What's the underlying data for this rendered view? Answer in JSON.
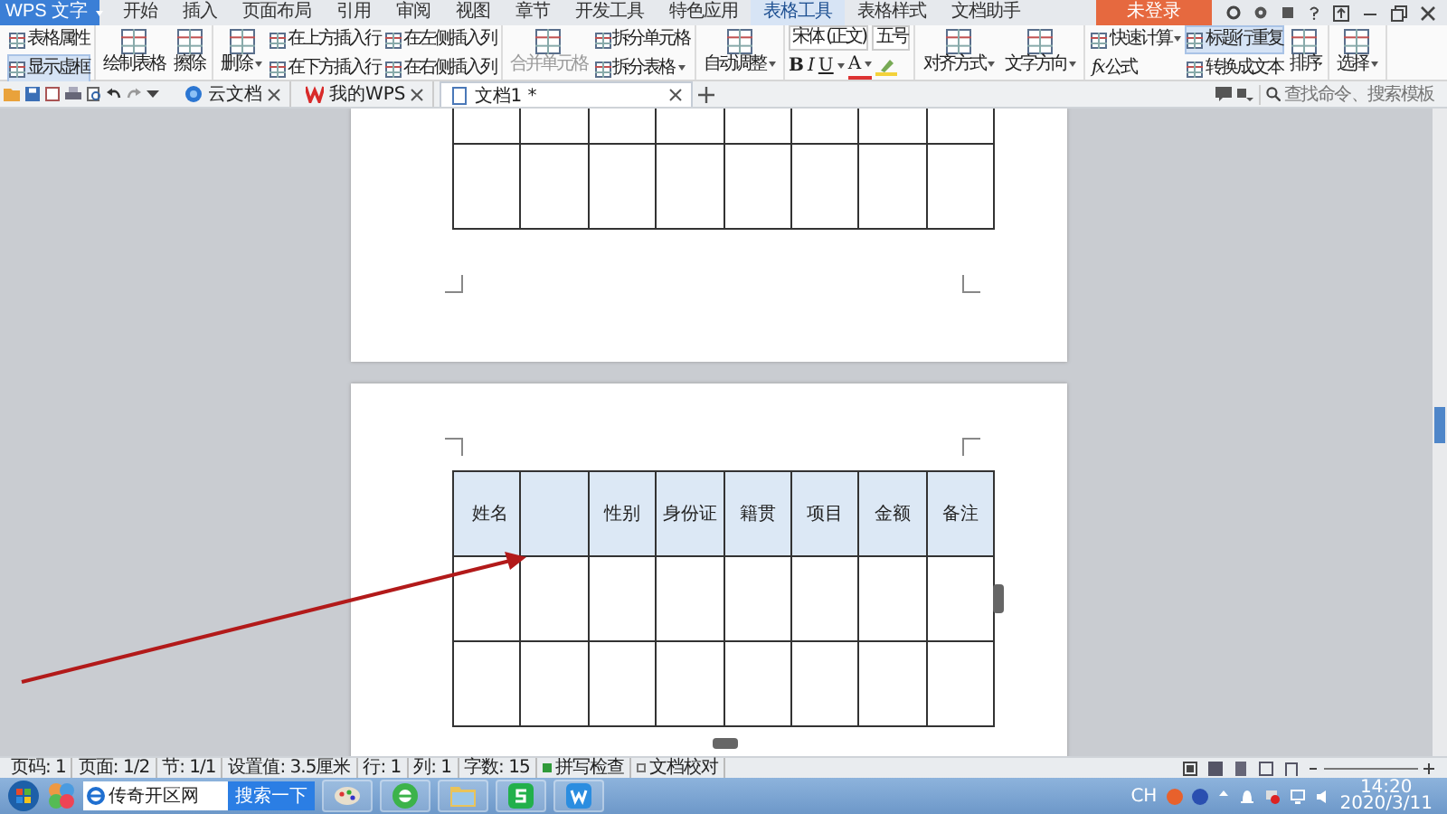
{
  "app_button": {
    "label": "WPS 文字"
  },
  "menu_tabs": [
    {
      "label": "开始",
      "selected": false
    },
    {
      "label": "插入",
      "selected": false
    },
    {
      "label": "页面布局",
      "selected": false
    },
    {
      "label": "引用",
      "selected": false
    },
    {
      "label": "审阅",
      "selected": false
    },
    {
      "label": "视图",
      "selected": false
    },
    {
      "label": "章节",
      "selected": false
    },
    {
      "label": "开发工具",
      "selected": false
    },
    {
      "label": "特色应用",
      "selected": false
    },
    {
      "label": "表格工具",
      "selected": true
    },
    {
      "label": "表格样式",
      "selected": false
    },
    {
      "label": "文档助手",
      "selected": false
    }
  ],
  "login_button": {
    "label": "未登录"
  },
  "ribbon": [
    {
      "columns": [
        {
          "kind": "small",
          "items": [
            {
              "label": "表格属性",
              "selected": false,
              "disabled": false,
              "dropdown": false
            },
            {
              "label": "显示虚框",
              "selected": true,
              "disabled": false,
              "dropdown": false
            }
          ]
        }
      ]
    },
    {
      "columns": [
        {
          "kind": "large",
          "items": [
            {
              "label": "绘制表格",
              "selected": false,
              "disabled": false,
              "dropdown": false
            }
          ]
        },
        {
          "kind": "large",
          "items": [
            {
              "label": "擦除",
              "selected": false,
              "disabled": false,
              "dropdown": false
            }
          ]
        }
      ]
    },
    {
      "columns": [
        {
          "kind": "large",
          "items": [
            {
              "label": "删除",
              "selected": false,
              "disabled": false,
              "dropdown": true
            }
          ]
        },
        {
          "kind": "small",
          "items": [
            {
              "label": "在上方插入行",
              "selected": false,
              "disabled": false,
              "dropdown": false
            },
            {
              "label": "在下方插入行",
              "selected": false,
              "disabled": false,
              "dropdown": false
            }
          ]
        },
        {
          "kind": "small",
          "items": [
            {
              "label": "在左侧插入列",
              "selected": false,
              "disabled": false,
              "dropdown": false
            },
            {
              "label": "在右侧插入列",
              "selected": false,
              "disabled": false,
              "dropdown": false
            }
          ]
        }
      ]
    },
    {
      "columns": [
        {
          "kind": "large",
          "items": [
            {
              "label": "合并单元格",
              "selected": false,
              "disabled": true,
              "dropdown": false
            }
          ]
        },
        {
          "kind": "small",
          "items": [
            {
              "label": "拆分单元格",
              "selected": false,
              "disabled": false,
              "dropdown": false
            },
            {
              "label": "拆分表格",
              "selected": false,
              "disabled": false,
              "dropdown": true
            }
          ]
        }
      ]
    },
    {
      "columns": [
        {
          "kind": "large",
          "items": [
            {
              "label": "自动调整",
              "selected": false,
              "disabled": false,
              "dropdown": true
            }
          ]
        }
      ]
    },
    {
      "columns": [
        {
          "kind": "font",
          "font_name": "宋体 (正文)",
          "font_size": "五号",
          "items": [
            {
              "label": "B",
              "selected": false,
              "disabled": false,
              "dropdown": false
            },
            {
              "label": "I",
              "selected": false,
              "disabled": false,
              "dropdown": false
            },
            {
              "label": "U",
              "selected": false,
              "disabled": false,
              "dropdown": true
            },
            {
              "label": "A",
              "selected": false,
              "disabled": false,
              "dropdown": true
            }
          ]
        }
      ]
    },
    {
      "columns": [
        {
          "kind": "large",
          "items": [
            {
              "label": "对齐方式",
              "selected": false,
              "disabled": false,
              "dropdown": true
            }
          ]
        },
        {
          "kind": "large",
          "items": [
            {
              "label": "文字方向",
              "selected": false,
              "disabled": false,
              "dropdown": true
            }
          ]
        }
      ]
    },
    {
      "columns": [
        {
          "kind": "small",
          "items": [
            {
              "label": "快速计算",
              "selected": false,
              "disabled": false,
              "dropdown": true
            },
            {
              "label": "公式",
              "symbol": "fx",
              "selected": false,
              "disabled": false,
              "dropdown": false
            }
          ]
        },
        {
          "kind": "small",
          "items": [
            {
              "label": "标题行重复",
              "selected": true,
              "disabled": false,
              "dropdown": false
            },
            {
              "label": "转换成文本",
              "selected": false,
              "disabled": false,
              "dropdown": false
            }
          ]
        },
        {
          "kind": "large",
          "items": [
            {
              "label": "排序",
              "selected": false,
              "disabled": false,
              "dropdown": false
            }
          ]
        }
      ]
    },
    {
      "columns": [
        {
          "kind": "large",
          "items": [
            {
              "label": "选择",
              "selected": false,
              "disabled": false,
              "dropdown": true
            }
          ]
        }
      ]
    }
  ],
  "doc_tabs": [
    {
      "label": "云文档",
      "selected": false
    },
    {
      "label": "我的WPS",
      "selected": false
    },
    {
      "label": "文档1 *",
      "selected": true
    }
  ],
  "command_search": {
    "placeholder": "查找命令、搜索模板"
  },
  "pages": [
    {
      "table": {
        "rows": [
          {
            "selected": false,
            "cells": []
          },
          {
            "selected": false,
            "cells": []
          }
        ]
      }
    },
    {
      "table": {
        "rows": [
          {
            "selected": true,
            "cells": [
              {
                "text": "姓名"
              },
              {},
              {
                "text": "性别"
              },
              {
                "text": "身份证"
              },
              {
                "text": "籍贯"
              },
              {
                "text": "项目"
              },
              {
                "text": "金额"
              },
              {
                "text": "备注"
              }
            ]
          },
          {
            "selected": false,
            "cells": []
          },
          {
            "selected": false,
            "cells": []
          }
        ]
      }
    }
  ],
  "status_bar": [
    {
      "kind": "text",
      "label": "页码: 1"
    },
    {
      "kind": "text",
      "label": "页面: 1/2"
    },
    {
      "kind": "text",
      "label": "节: 1/1"
    },
    {
      "kind": "text",
      "label": "设置值: 3.5厘米"
    },
    {
      "kind": "text",
      "label": "行: 1"
    },
    {
      "kind": "text",
      "label": "列: 1"
    },
    {
      "kind": "text",
      "label": "字数: 15"
    },
    {
      "kind": "check",
      "label": "拼写检查",
      "checked": true
    },
    {
      "kind": "check",
      "label": "文档校对",
      "checked": false
    }
  ],
  "taskbar": {
    "search_value": "传奇开区网",
    "search_button": "搜索一下",
    "input_language": "CH",
    "time": "14:20",
    "date": "2020/3/11"
  }
}
